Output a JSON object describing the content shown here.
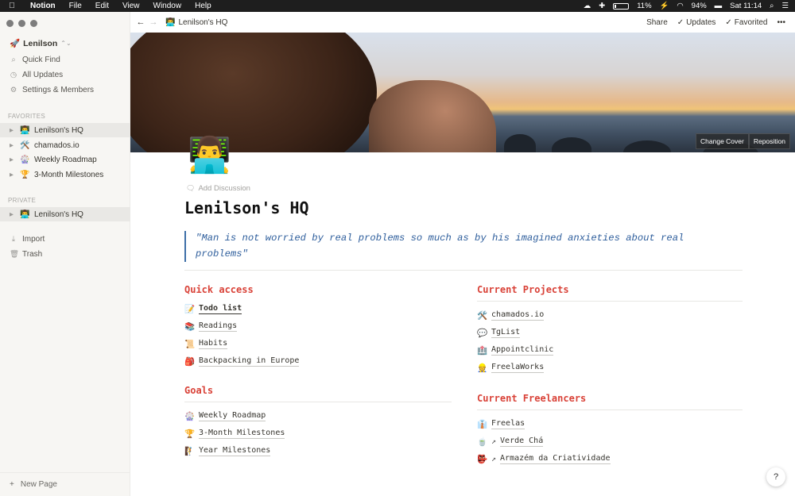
{
  "menubar": {
    "app": "Notion",
    "menus": [
      "File",
      "Edit",
      "View",
      "Window",
      "Help"
    ],
    "battery": "11%",
    "wifi": "94%",
    "clock": "Sat 11:14"
  },
  "sidebar": {
    "workspace": "Lenilson",
    "links": [
      {
        "icon": "search-icon",
        "label": "Quick Find"
      },
      {
        "icon": "clock-icon",
        "label": "All Updates"
      },
      {
        "icon": "gear-icon",
        "label": "Settings & Members"
      }
    ],
    "favorites_title": "FAVORITES",
    "favorites": [
      {
        "emoji": "👨‍💻",
        "label": "Lenilson's HQ"
      },
      {
        "emoji": "🛠️",
        "label": "chamados.io"
      },
      {
        "emoji": "🎡",
        "label": "Weekly Roadmap"
      },
      {
        "emoji": "🏆",
        "label": "3-Month Milestones"
      }
    ],
    "private_title": "PRIVATE",
    "private": [
      {
        "emoji": "👨‍💻",
        "label": "Lenilson's HQ"
      }
    ],
    "bottom_links": [
      {
        "icon": "import-icon",
        "label": "Import"
      },
      {
        "icon": "trash-icon",
        "label": "Trash"
      }
    ],
    "new_page": "New Page"
  },
  "topbar": {
    "breadcrumb_emoji": "👨‍💻",
    "breadcrumb": "Lenilson's HQ",
    "share": "Share",
    "updates": "Updates",
    "favorited": "Favorited"
  },
  "cover": {
    "change_cover": "Change Cover",
    "reposition": "Reposition"
  },
  "page": {
    "icon": "👨‍💻",
    "add_discussion": "Add Discussion",
    "title": "Lenilson's HQ",
    "quote": "\"Man is not worried by real problems so much as by his imagined anxieties about real problems\""
  },
  "quick_access": {
    "title": "Quick access",
    "items": [
      {
        "emoji": "📝",
        "label": "Todo list"
      },
      {
        "emoji": "📚",
        "label": "Readings"
      },
      {
        "emoji": "📜",
        "label": "Habits"
      },
      {
        "emoji": "🎒",
        "label": "Backpacking in Europe"
      }
    ]
  },
  "goals": {
    "title": "Goals",
    "items": [
      {
        "emoji": "🎡",
        "label": "Weekly Roadmap"
      },
      {
        "emoji": "🏆",
        "label": "3-Month Milestones"
      },
      {
        "emoji": "🧗",
        "label": "Year Milestones"
      }
    ]
  },
  "projects": {
    "title": "Current Projects",
    "items": [
      {
        "emoji": "🛠️",
        "label": "chamados.io"
      },
      {
        "emoji": "💬",
        "label": "TgList"
      },
      {
        "emoji": "🏥",
        "label": "Appointclinic"
      },
      {
        "emoji": "👷",
        "label": "FreelaWorks"
      }
    ]
  },
  "freelancers": {
    "title": "Current Freelancers",
    "items": [
      {
        "emoji": "👔",
        "label": "Freelas"
      },
      {
        "emoji": "🍵",
        "label": "Verde Chá"
      },
      {
        "emoji": "👺",
        "label": "Armazém da Criatividade"
      }
    ]
  },
  "help": "?"
}
